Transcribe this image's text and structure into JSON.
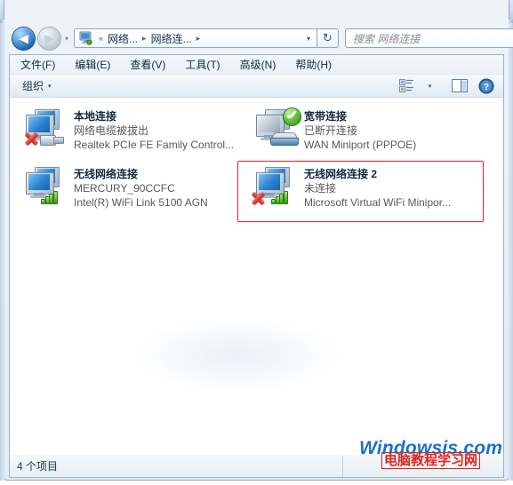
{
  "window": {
    "controls": {
      "minimize_label": "–",
      "maximize_label": "□",
      "close_label": "✕"
    }
  },
  "address_bar": {
    "back_glyph": "◀",
    "forward_glyph": "▶",
    "history_glyph": "▾",
    "crumb_1": "网络...",
    "crumb_sep_1": "▸",
    "crumb_2": "网络连...",
    "crumb_sep_2": "▸",
    "leading_sep": "«",
    "dropdown_glyph": "▾",
    "refresh_glyph": "↻"
  },
  "search": {
    "placeholder": "搜索 网络连接",
    "value": "",
    "icon_glyph": "⌕"
  },
  "menu": {
    "items": [
      {
        "label": "文件(F)"
      },
      {
        "label": "编辑(E)"
      },
      {
        "label": "查看(V)"
      },
      {
        "label": "工具(T)"
      },
      {
        "label": "高级(N)"
      },
      {
        "label": "帮助(H)"
      }
    ]
  },
  "toolbar": {
    "organize_label": "组织",
    "organize_caret": "▾",
    "views_caret": "▾",
    "help_glyph": "?"
  },
  "connections": [
    {
      "name": "本地连接",
      "status": "网络电缆被拔出",
      "device": "Realtek PCIe FE Family Control...",
      "icon": "network-disconnected-cable-icon",
      "badge": "red-x-badge",
      "highlighted": false
    },
    {
      "name": "宽带连接",
      "status": "已断开连接",
      "device": "WAN Miniport (PPPOE)",
      "icon": "wan-modem-icon",
      "badge": "green-check-badge",
      "highlighted": false
    },
    {
      "name": "无线网络连接",
      "status": "MERCURY_90CCFC",
      "device": "Intel(R) WiFi Link 5100 AGN",
      "icon": "wireless-signal-icon",
      "badge": "none",
      "highlighted": false
    },
    {
      "name": "无线网络连接 2",
      "status": "未连接",
      "device": "Microsoft Virtual WiFi Minipor...",
      "icon": "wireless-signal-icon",
      "badge": "red-x-badge",
      "highlighted": true
    }
  ],
  "status_bar": {
    "item_count": "4 个项目"
  },
  "watermark": {
    "english": "Windowsis.com",
    "chinese": "电脑教程学习网"
  },
  "colors": {
    "highlight_red": "#d8323c",
    "watermark_blue": "#1a6fd4",
    "watermark_red": "#e2231a",
    "accent_green": "#3f9e19"
  }
}
